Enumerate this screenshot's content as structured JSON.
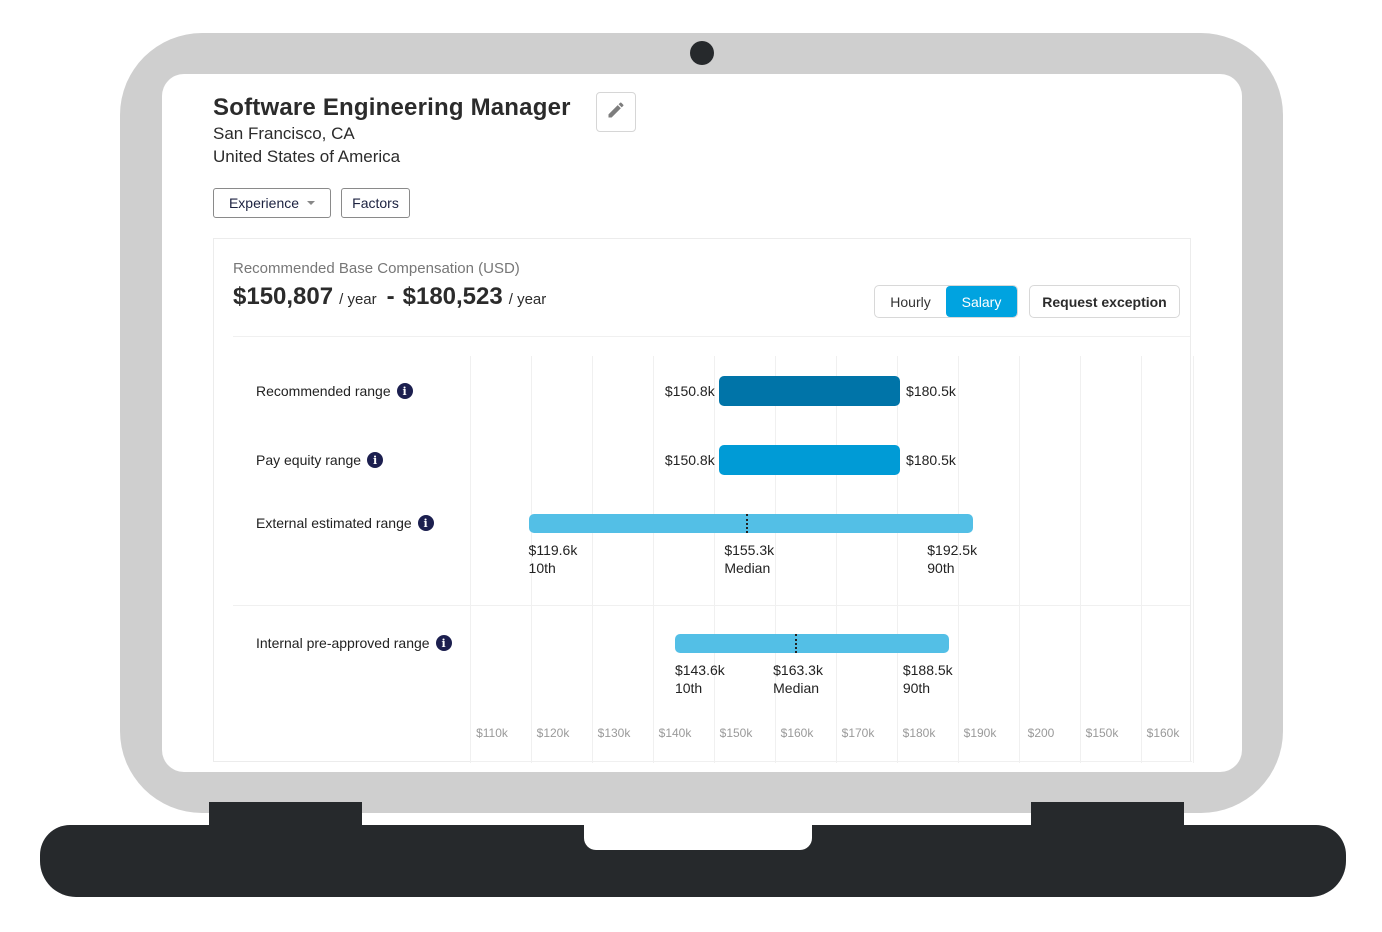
{
  "header": {
    "job_title": "Software Engineering Manager",
    "location_city": "San Francisco, CA",
    "location_country": "United States of America",
    "edit_icon": "pencil-icon",
    "experience_label": "Experience",
    "factors_label": "Factors"
  },
  "compensation": {
    "title": "Recommended Base Compensation (USD)",
    "low": "$150,807",
    "high": "$180,523",
    "per": "/ year",
    "dash": "-",
    "toggle": {
      "hourly": "Hourly",
      "salary": "Salary",
      "selected": "Salary"
    },
    "request_exception": "Request exception"
  },
  "colors": {
    "recommended": "#0074a8",
    "pay_equity": "#009bd6",
    "external": "#53bfe6",
    "internal": "#53bfe6",
    "accent": "#00a3e0",
    "info_icon": "#1c1f4f"
  },
  "chart_data": {
    "type": "range-bar",
    "unit": "USD thousands",
    "x_ticks": [
      "$110k",
      "$120k",
      "$130k",
      "$140k",
      "$150k",
      "$160k",
      "$170k",
      "$180k",
      "$190k",
      "$200",
      "$150k",
      "$160k"
    ],
    "rows": [
      {
        "label": "Recommended range",
        "low": 150.8,
        "high": 180.5,
        "low_label": "$150.8k",
        "high_label": "$180.5k",
        "color_key": "recommended"
      },
      {
        "label": "Pay equity range",
        "low": 150.8,
        "high": 180.5,
        "low_label": "$150.8k",
        "high_label": "$180.5k",
        "color_key": "pay_equity"
      },
      {
        "label": "External estimated range",
        "low": 119.6,
        "median": 155.3,
        "high": 192.5,
        "low_label": "$119.6k",
        "median_label": "$155.3k",
        "high_label": "$192.5k",
        "low_pct": "10th",
        "median_pct": "Median",
        "high_pct": "90th",
        "color_key": "external"
      },
      {
        "label": "Internal pre-approved range",
        "low": 143.6,
        "median": 163.3,
        "high": 188.5,
        "low_label": "$143.6k",
        "median_label": "$163.3k",
        "high_label": "$188.5k",
        "low_pct": "10th",
        "median_pct": "Median",
        "high_pct": "90th",
        "color_key": "internal"
      }
    ]
  }
}
